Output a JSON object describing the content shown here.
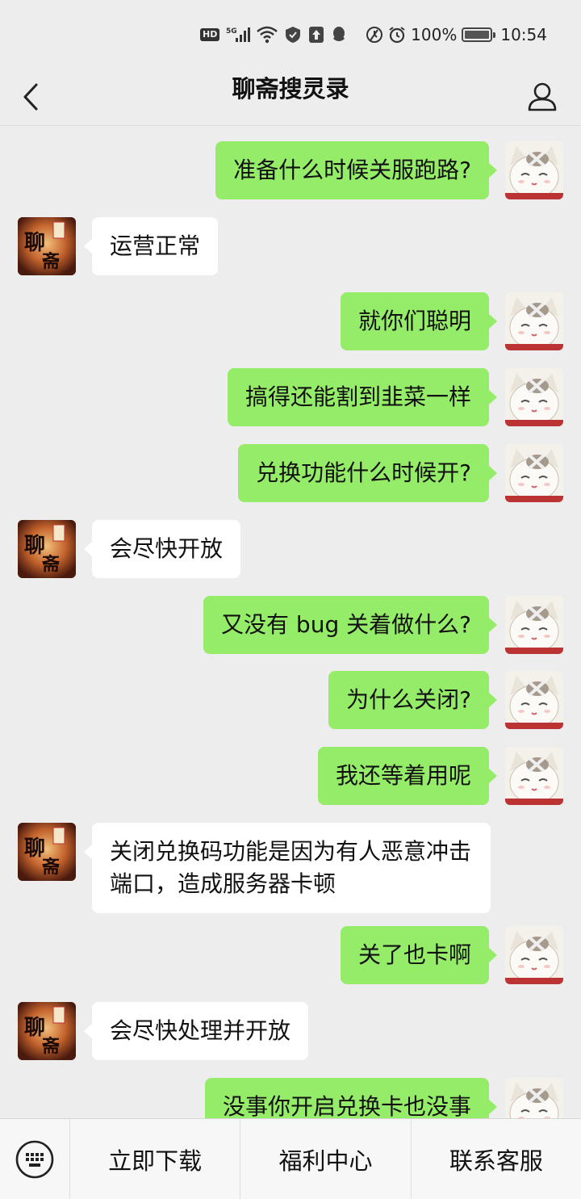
{
  "status_bar": {
    "hd": "HD",
    "network": "5G",
    "battery": "100%",
    "time": "10:54",
    "icons": [
      "hd-icon",
      "signal-5g-icon",
      "wifi-icon",
      "shield-icon",
      "upload-icon",
      "qq-icon",
      "alarm-icon",
      "clock-icon",
      "battery-icon"
    ]
  },
  "header": {
    "title": "聊斋搜灵录",
    "back_icon": "back-chevron-icon",
    "profile_icon": "person-icon"
  },
  "messages": [
    {
      "side": "right",
      "text": "准备什么时候关服跑路?"
    },
    {
      "side": "left",
      "text": "运营正常"
    },
    {
      "side": "right",
      "text": "就你们聪明"
    },
    {
      "side": "right",
      "text": "搞得还能割到韭菜一样"
    },
    {
      "side": "right",
      "text": "兑换功能什么时候开?"
    },
    {
      "side": "left",
      "text": "会尽快开放"
    },
    {
      "side": "right",
      "text": "又没有 bug 关着做什么?"
    },
    {
      "side": "right",
      "text": "为什么关闭?"
    },
    {
      "side": "right",
      "text": "我还等着用呢"
    },
    {
      "side": "left",
      "text": "关闭兑换码功能是因为有人恶意冲击端口，造成服务器卡顿"
    },
    {
      "side": "right",
      "text": "关了也卡啊"
    },
    {
      "side": "left",
      "text": "会尽快处理并开放"
    },
    {
      "side": "right",
      "text": "没事你开启兑换卡也没事"
    }
  ],
  "avatars": {
    "game_logo_text": "聊斋"
  },
  "bottom_menu": {
    "keyboard_icon": "keyboard-icon",
    "items": [
      "立即下载",
      "福利中心",
      "联系客服"
    ]
  },
  "colors": {
    "background": "#ededed",
    "sent_bubble": "#95ec69",
    "received_bubble": "#ffffff"
  }
}
